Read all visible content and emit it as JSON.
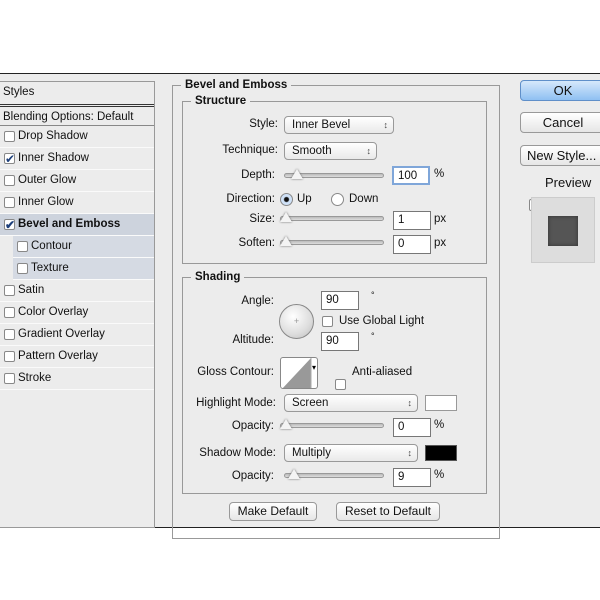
{
  "styles_list": {
    "header": "Styles",
    "blending": "Blending Options: Default",
    "items": [
      {
        "label": "Drop Shadow",
        "checked": false
      },
      {
        "label": "Inner Shadow",
        "checked": true
      },
      {
        "label": "Outer Glow",
        "checked": false
      },
      {
        "label": "Inner Glow",
        "checked": false
      },
      {
        "label": "Bevel and Emboss",
        "checked": true,
        "selected": true
      },
      {
        "label": "Contour",
        "checked": false,
        "sub": true
      },
      {
        "label": "Texture",
        "checked": false,
        "sub": true
      },
      {
        "label": "Satin",
        "checked": false
      },
      {
        "label": "Color Overlay",
        "checked": false
      },
      {
        "label": "Gradient Overlay",
        "checked": false
      },
      {
        "label": "Pattern Overlay",
        "checked": false
      },
      {
        "label": "Stroke",
        "checked": false
      }
    ]
  },
  "panel": {
    "title": "Bevel and Emboss",
    "structure": {
      "title": "Structure",
      "style_label": "Style:",
      "style": "Inner Bevel",
      "technique_label": "Technique:",
      "technique": "Smooth",
      "depth_label": "Depth:",
      "depth": "100",
      "depth_unit": "%",
      "direction_label": "Direction:",
      "up": "Up",
      "down": "Down",
      "direction": "Up",
      "size_label": "Size:",
      "size": "1",
      "size_unit": "px",
      "soften_label": "Soften:",
      "soften": "0",
      "soften_unit": "px"
    },
    "shading": {
      "title": "Shading",
      "angle_label": "Angle:",
      "angle": "90",
      "deg": "°",
      "global_light": "Use Global Light",
      "altitude_label": "Altitude:",
      "altitude": "90",
      "gloss_label": "Gloss Contour:",
      "anti_aliased": "Anti-aliased",
      "highlight_label": "Highlight Mode:",
      "highlight_mode": "Screen",
      "highlight_color": "#ffffff",
      "opacity_label": "Opacity:",
      "highlight_opacity": "0",
      "pct": "%",
      "shadow_label": "Shadow Mode:",
      "shadow_mode": "Multiply",
      "shadow_color": "#000000",
      "shadow_opacity": "9"
    },
    "make_default": "Make Default",
    "reset_default": "Reset to Default"
  },
  "buttons": {
    "ok": "OK",
    "cancel": "Cancel",
    "new_style": "New Style...",
    "preview": "Preview",
    "preview_checked": true
  }
}
